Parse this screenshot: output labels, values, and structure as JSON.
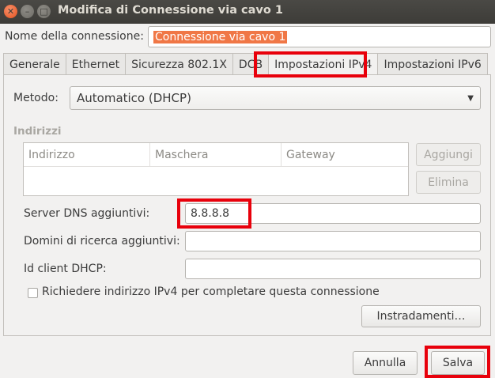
{
  "window": {
    "title": "Modifica di Connessione via cavo 1"
  },
  "connection": {
    "name_label": "Nome della connessione:",
    "name_value": "Connessione via cavo 1"
  },
  "tabs": [
    {
      "label": "Generale"
    },
    {
      "label": "Ethernet"
    },
    {
      "label": "Sicurezza 802.1X"
    },
    {
      "label": "DCB"
    },
    {
      "label": "Impostazioni IPv4",
      "active": true
    },
    {
      "label": "Impostazioni IPv6"
    }
  ],
  "ipv4": {
    "method_label": "Metodo:",
    "method_value": "Automatico (DHCP)",
    "addresses_label": "Indirizzi",
    "columns": [
      "Indirizzo",
      "Maschera",
      "Gateway"
    ],
    "add_label": "Aggiungi",
    "delete_label": "Elimina",
    "dns_label": "Server DNS aggiuntivi:",
    "dns_value": "8.8.8.8",
    "search_label": "Domini di ricerca aggiuntivi:",
    "search_value": "",
    "dhcp_label": "Id client DHCP:",
    "dhcp_value": "",
    "require_label": "Richiedere indirizzo IPv4 per completare questa connessione",
    "require_checked": false,
    "routes_label": "Instradamenti…"
  },
  "footer": {
    "cancel_label": "Annulla",
    "save_label": "Salva"
  },
  "colors": {
    "highlight": "#e8000b",
    "selection": "#f07746",
    "titlebar": "#3d3c38"
  },
  "icons": {
    "close": "close-icon",
    "minimize": "minimize-icon",
    "maximize": "maximize-icon",
    "dropdown": "chevron-down-icon"
  }
}
